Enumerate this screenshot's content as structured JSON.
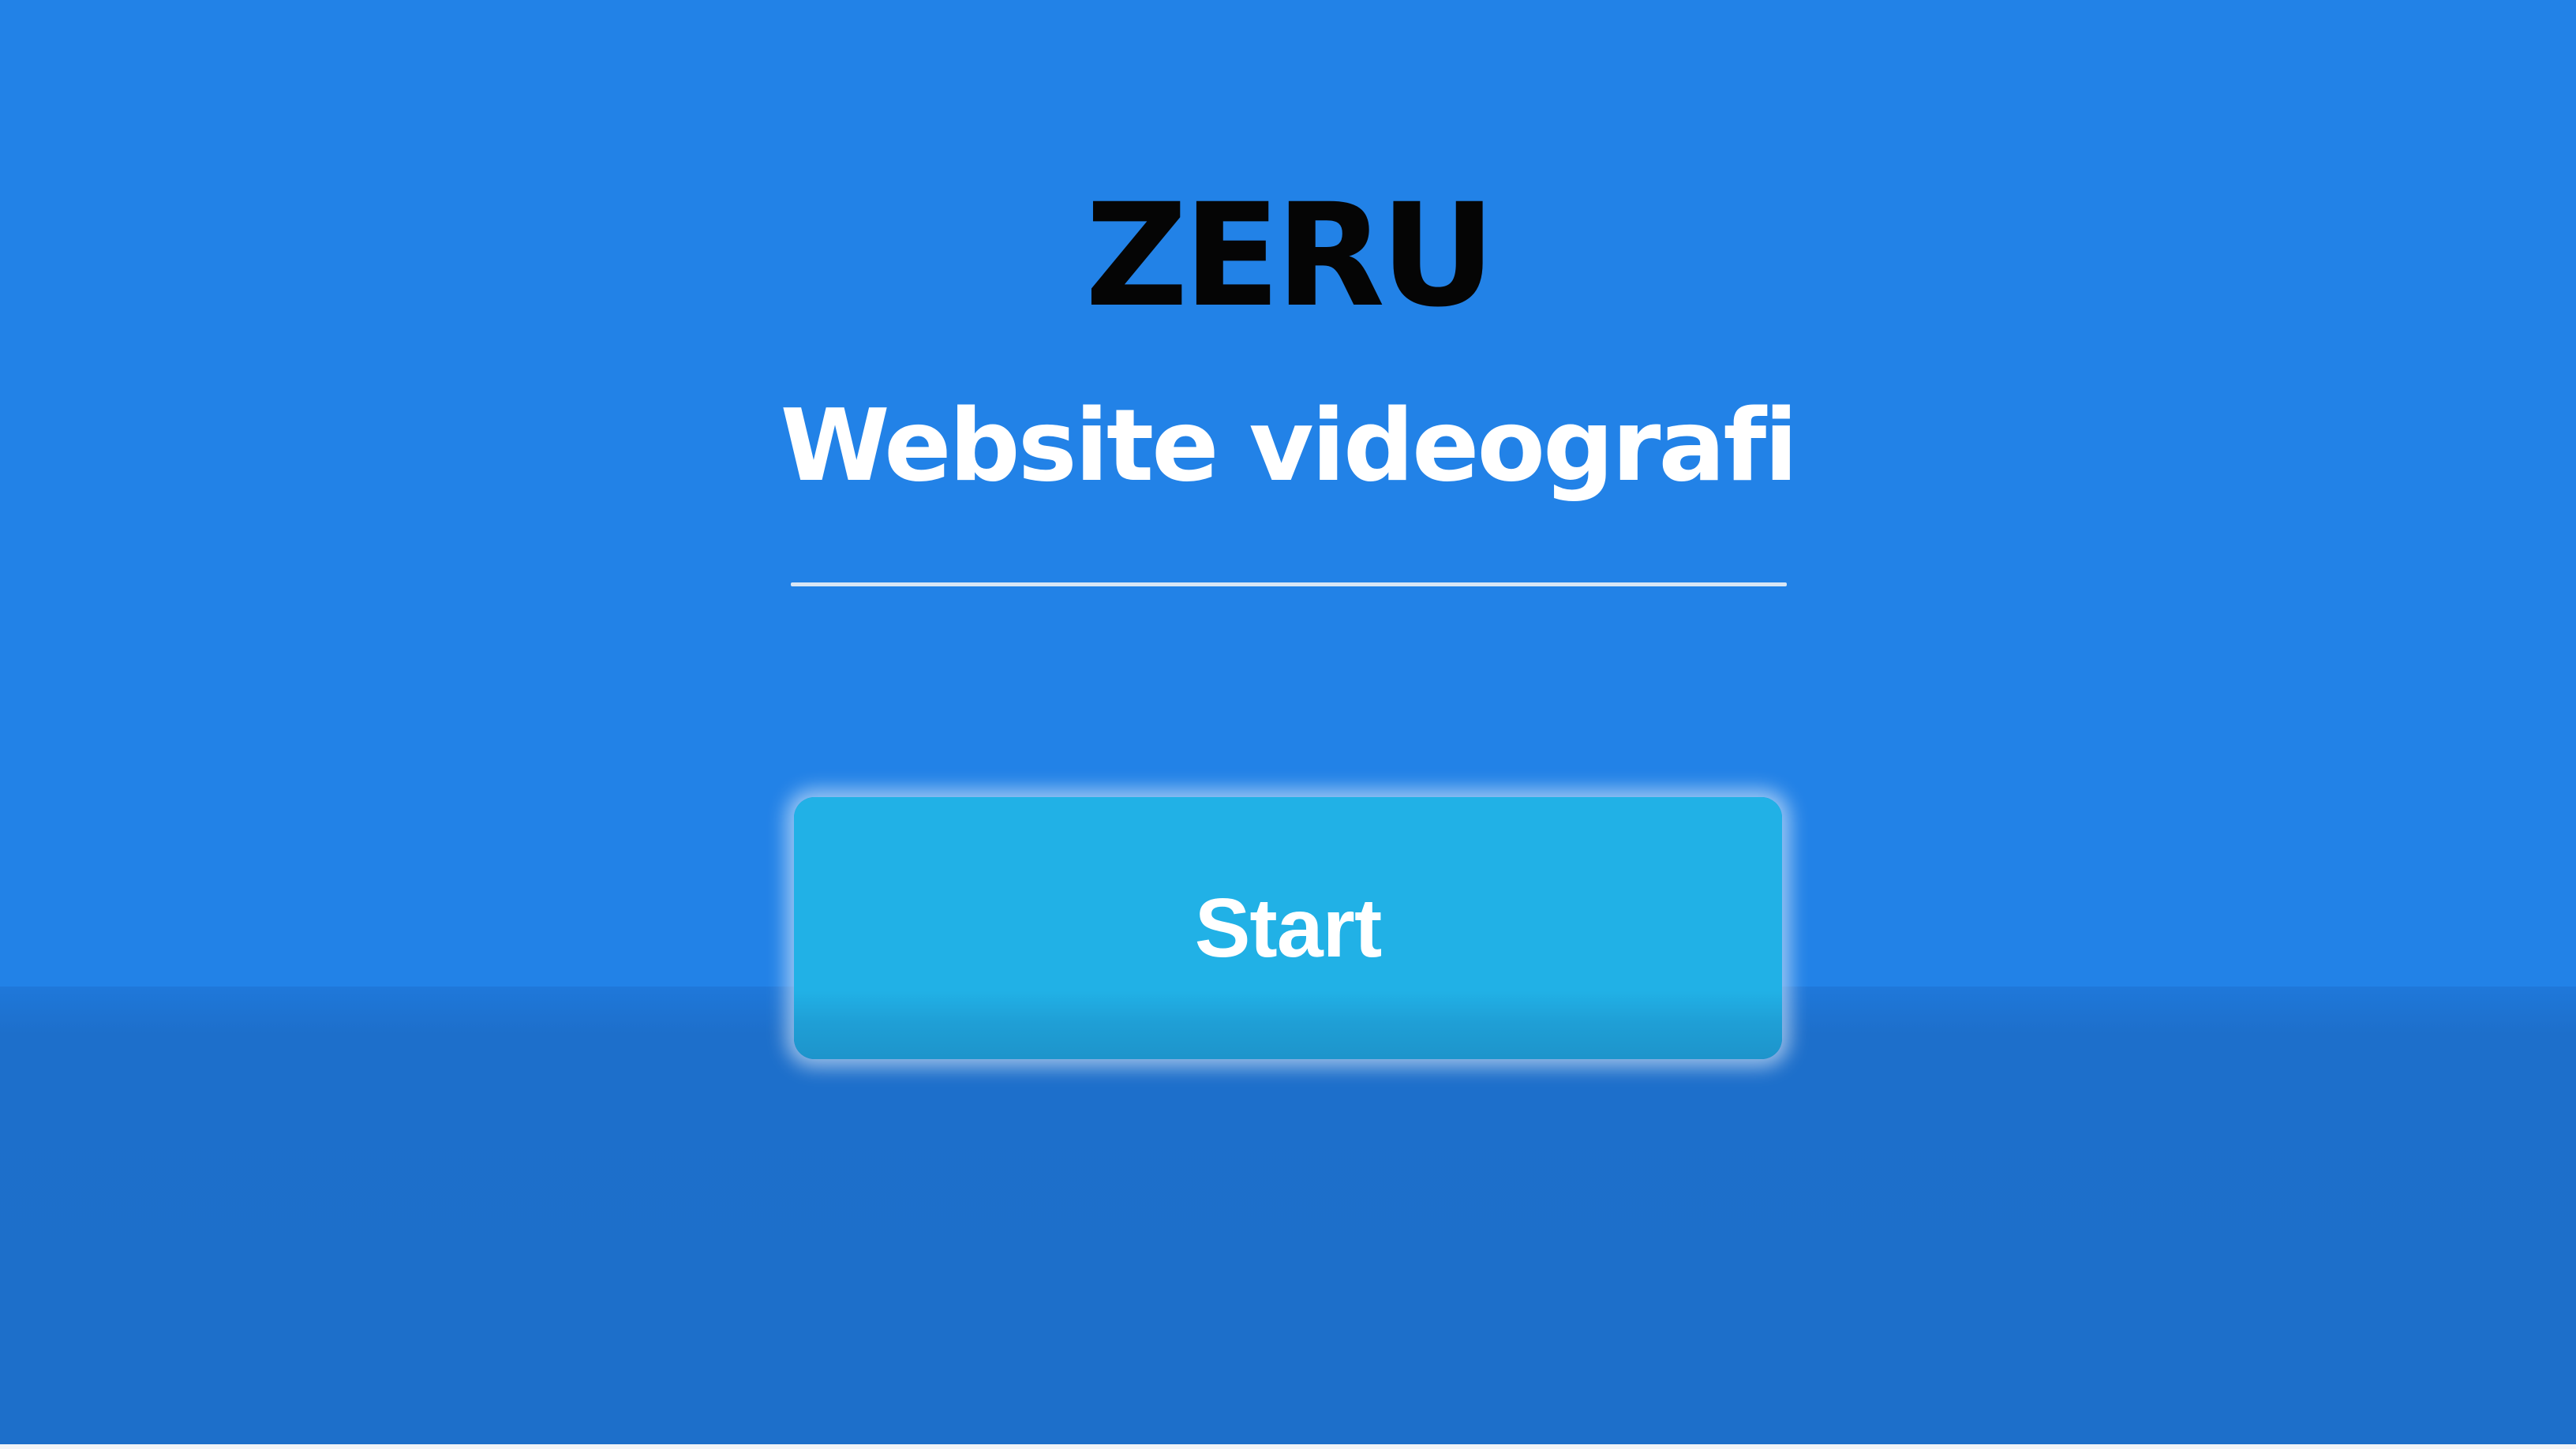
{
  "hero": {
    "brand": "ZERU",
    "subtitle": "Website videografi",
    "start_label": "Start"
  },
  "colors": {
    "background": "#2281e6",
    "background_lower": "#1d6fca",
    "button": "#21b1e6",
    "brand_text": "#050505",
    "subtitle_text": "#ffffff"
  }
}
